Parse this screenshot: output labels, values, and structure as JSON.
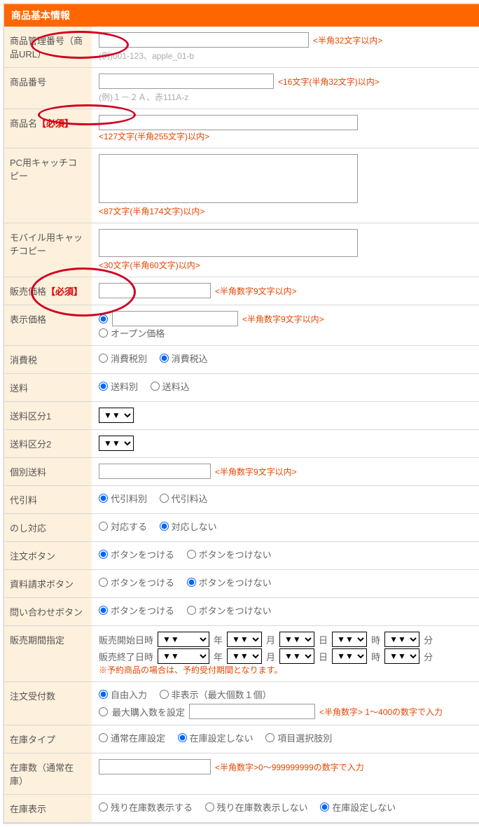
{
  "header": "商品基本情報",
  "fields": {
    "mgmtNo": {
      "label": "商品管理番号（商品URL）",
      "hint": "<半角32文字以内>",
      "example": "(例)001-123、apple_01-b"
    },
    "itemNo": {
      "label": "商品番号",
      "hint": "<16文字(半角32文字)以内>",
      "example": "(例)１－２Ａ、赤111A-z"
    },
    "name": {
      "label": "商品名",
      "req": "【必須】",
      "hint": "<127文字(半角255文字)以内>"
    },
    "pcCatch": {
      "label": "PC用キャッチコピー",
      "hint": "<87文字(半角174文字)以内>"
    },
    "mbCatch": {
      "label": "モバイル用キャッチコピー",
      "hint": "<30文字(半角60文字)以内>"
    },
    "price": {
      "label": "販売価格",
      "req": "【必須】",
      "hint": "<半角数字9文字以内>"
    },
    "disp": {
      "label": "表示価格",
      "hint": "<半角数字9文字以内>",
      "open": "オープン価格"
    },
    "tax": {
      "label": "消費税",
      "a": "消費税別",
      "b": "消費税込"
    },
    "ship": {
      "label": "送料",
      "a": "送料別",
      "b": "送料込"
    },
    "shipK1": {
      "label": "送料区分1"
    },
    "shipK2": {
      "label": "送料区分2"
    },
    "indShip": {
      "label": "個別送料",
      "hint": "<半角数字9文字以内>"
    },
    "cod": {
      "label": "代引料",
      "a": "代引料別",
      "b": "代引料込"
    },
    "noshi": {
      "label": "のし対応",
      "a": "対応する",
      "b": "対応しない"
    },
    "orderBtn": {
      "label": "注文ボタン",
      "a": "ボタンをつける",
      "b": "ボタンをつけない"
    },
    "docBtn": {
      "label": "資料請求ボタン",
      "a": "ボタンをつける",
      "b": "ボタンをつけない"
    },
    "inqBtn": {
      "label": "問い合わせボタン",
      "a": "ボタンをつける",
      "b": "ボタンをつけない"
    },
    "period": {
      "label": "販売期間指定",
      "start": "販売開始日時",
      "end": "販売終了日時",
      "y": "年",
      "m": "月",
      "d": "日",
      "h": "時",
      "mi": "分",
      "note": "※予約商品の場合は、予約受付期間となります。"
    },
    "qty": {
      "label": "注文受付数",
      "a": "自由入力",
      "b": "非表示（最大個数１個）",
      "c": "最大購入数を設定",
      "hint": "<半角数字> 1～400の数字で入力"
    },
    "stockT": {
      "label": "在庫タイプ",
      "a": "通常在庫設定",
      "b": "在庫設定しない",
      "c": "項目選択肢別"
    },
    "stockN": {
      "label": "在庫数（通常在庫）",
      "hint": "<半角数字>0～999999999の数字で入力"
    },
    "stockD": {
      "label": "在庫表示",
      "a": "残り在庫数表示する",
      "b": "残り在庫数表示しない",
      "c": "在庫設定しない"
    }
  }
}
